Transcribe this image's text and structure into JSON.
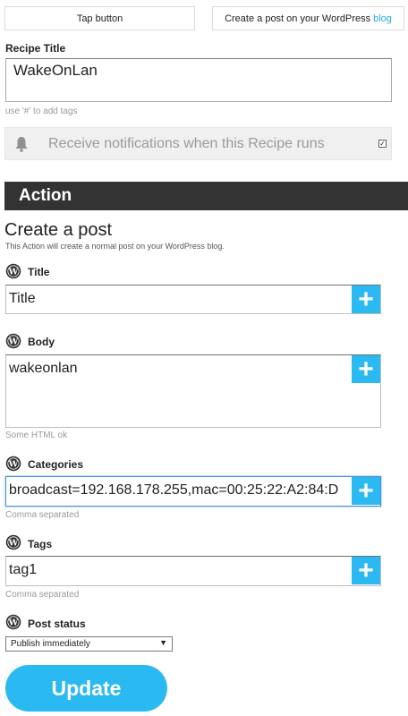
{
  "tabs": {
    "left_label": "Tap button",
    "right_label": "Create a post on your WordPress",
    "right_link": "blog"
  },
  "recipe": {
    "title_label": "Recipe Title",
    "title_value": "WakeOnLan",
    "tags_hint": "use '#' to add tags",
    "notification_text": "Receive notifications when this Recipe runs",
    "notification_checked": "✓"
  },
  "action": {
    "bar_label": "Action",
    "name": "Create a post",
    "description": "This Action will create a normal post on your WordPress blog."
  },
  "fields": {
    "title": {
      "label": "Title",
      "value": "Title"
    },
    "body": {
      "label": "Body",
      "value": "wakeonlan",
      "hint": "Some HTML ok"
    },
    "categories": {
      "label": "Categories",
      "value": "broadcast=192.168.178.255,mac=00:25:22:A2:84:D",
      "hint": "Comma separated"
    },
    "tags": {
      "label": "Tags",
      "value": "tag1",
      "hint": "Comma separated"
    },
    "post_status": {
      "label": "Post status",
      "selected": "Publish immediately",
      "arrow": "▼"
    }
  },
  "plus_symbol": "+",
  "update_label": "Update",
  "colors": {
    "accent": "#2bb9f2",
    "action_bar": "#333333",
    "link": "#27a9e1"
  },
  "icons": {
    "bell": "bell-icon",
    "wordpress": "wordpress-icon",
    "plus": "plus-icon"
  }
}
